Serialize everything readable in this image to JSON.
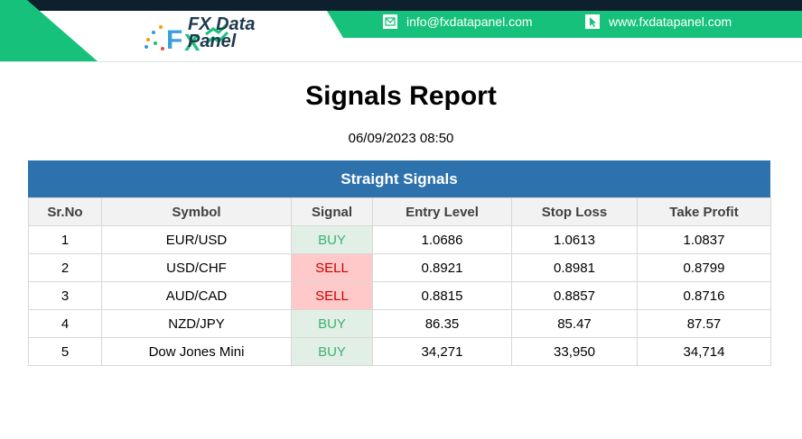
{
  "header": {
    "brand_line1": "FX Data",
    "brand_line2": "Panel",
    "email": "info@fxdatapanel.com",
    "website": "www.fxdatapanel.com",
    "colors": {
      "green": "#16c27b",
      "navy": "#0e1f2e"
    }
  },
  "report": {
    "title": "Signals Report",
    "datetime": "06/09/2023 08:50"
  },
  "table": {
    "title": "Straight Signals",
    "headers": [
      "Sr.No",
      "Symbol",
      "Signal",
      "Entry Level",
      "Stop Loss",
      "Take Profit"
    ],
    "rows": [
      [
        "1",
        "EUR/USD",
        "BUY",
        "1.0686",
        "1.0613",
        "1.0837"
      ],
      [
        "2",
        "USD/CHF",
        "SELL",
        "0.8921",
        "0.8981",
        "0.8799"
      ],
      [
        "3",
        "AUD/CAD",
        "SELL",
        "0.8815",
        "0.8857",
        "0.8716"
      ],
      [
        "4",
        "NZD/JPY",
        "BUY",
        "86.35",
        "85.47",
        "87.57"
      ],
      [
        "5",
        "Dow Jones Mini",
        "BUY",
        "34,271",
        "33,950",
        "34,714"
      ]
    ],
    "colors": {
      "header_band": "#2e72ad",
      "buy_bg": "#e2efe6",
      "buy_text": "#3cb371",
      "sell_bg": "#ffc9c9",
      "sell_text": "#cc0000"
    }
  }
}
